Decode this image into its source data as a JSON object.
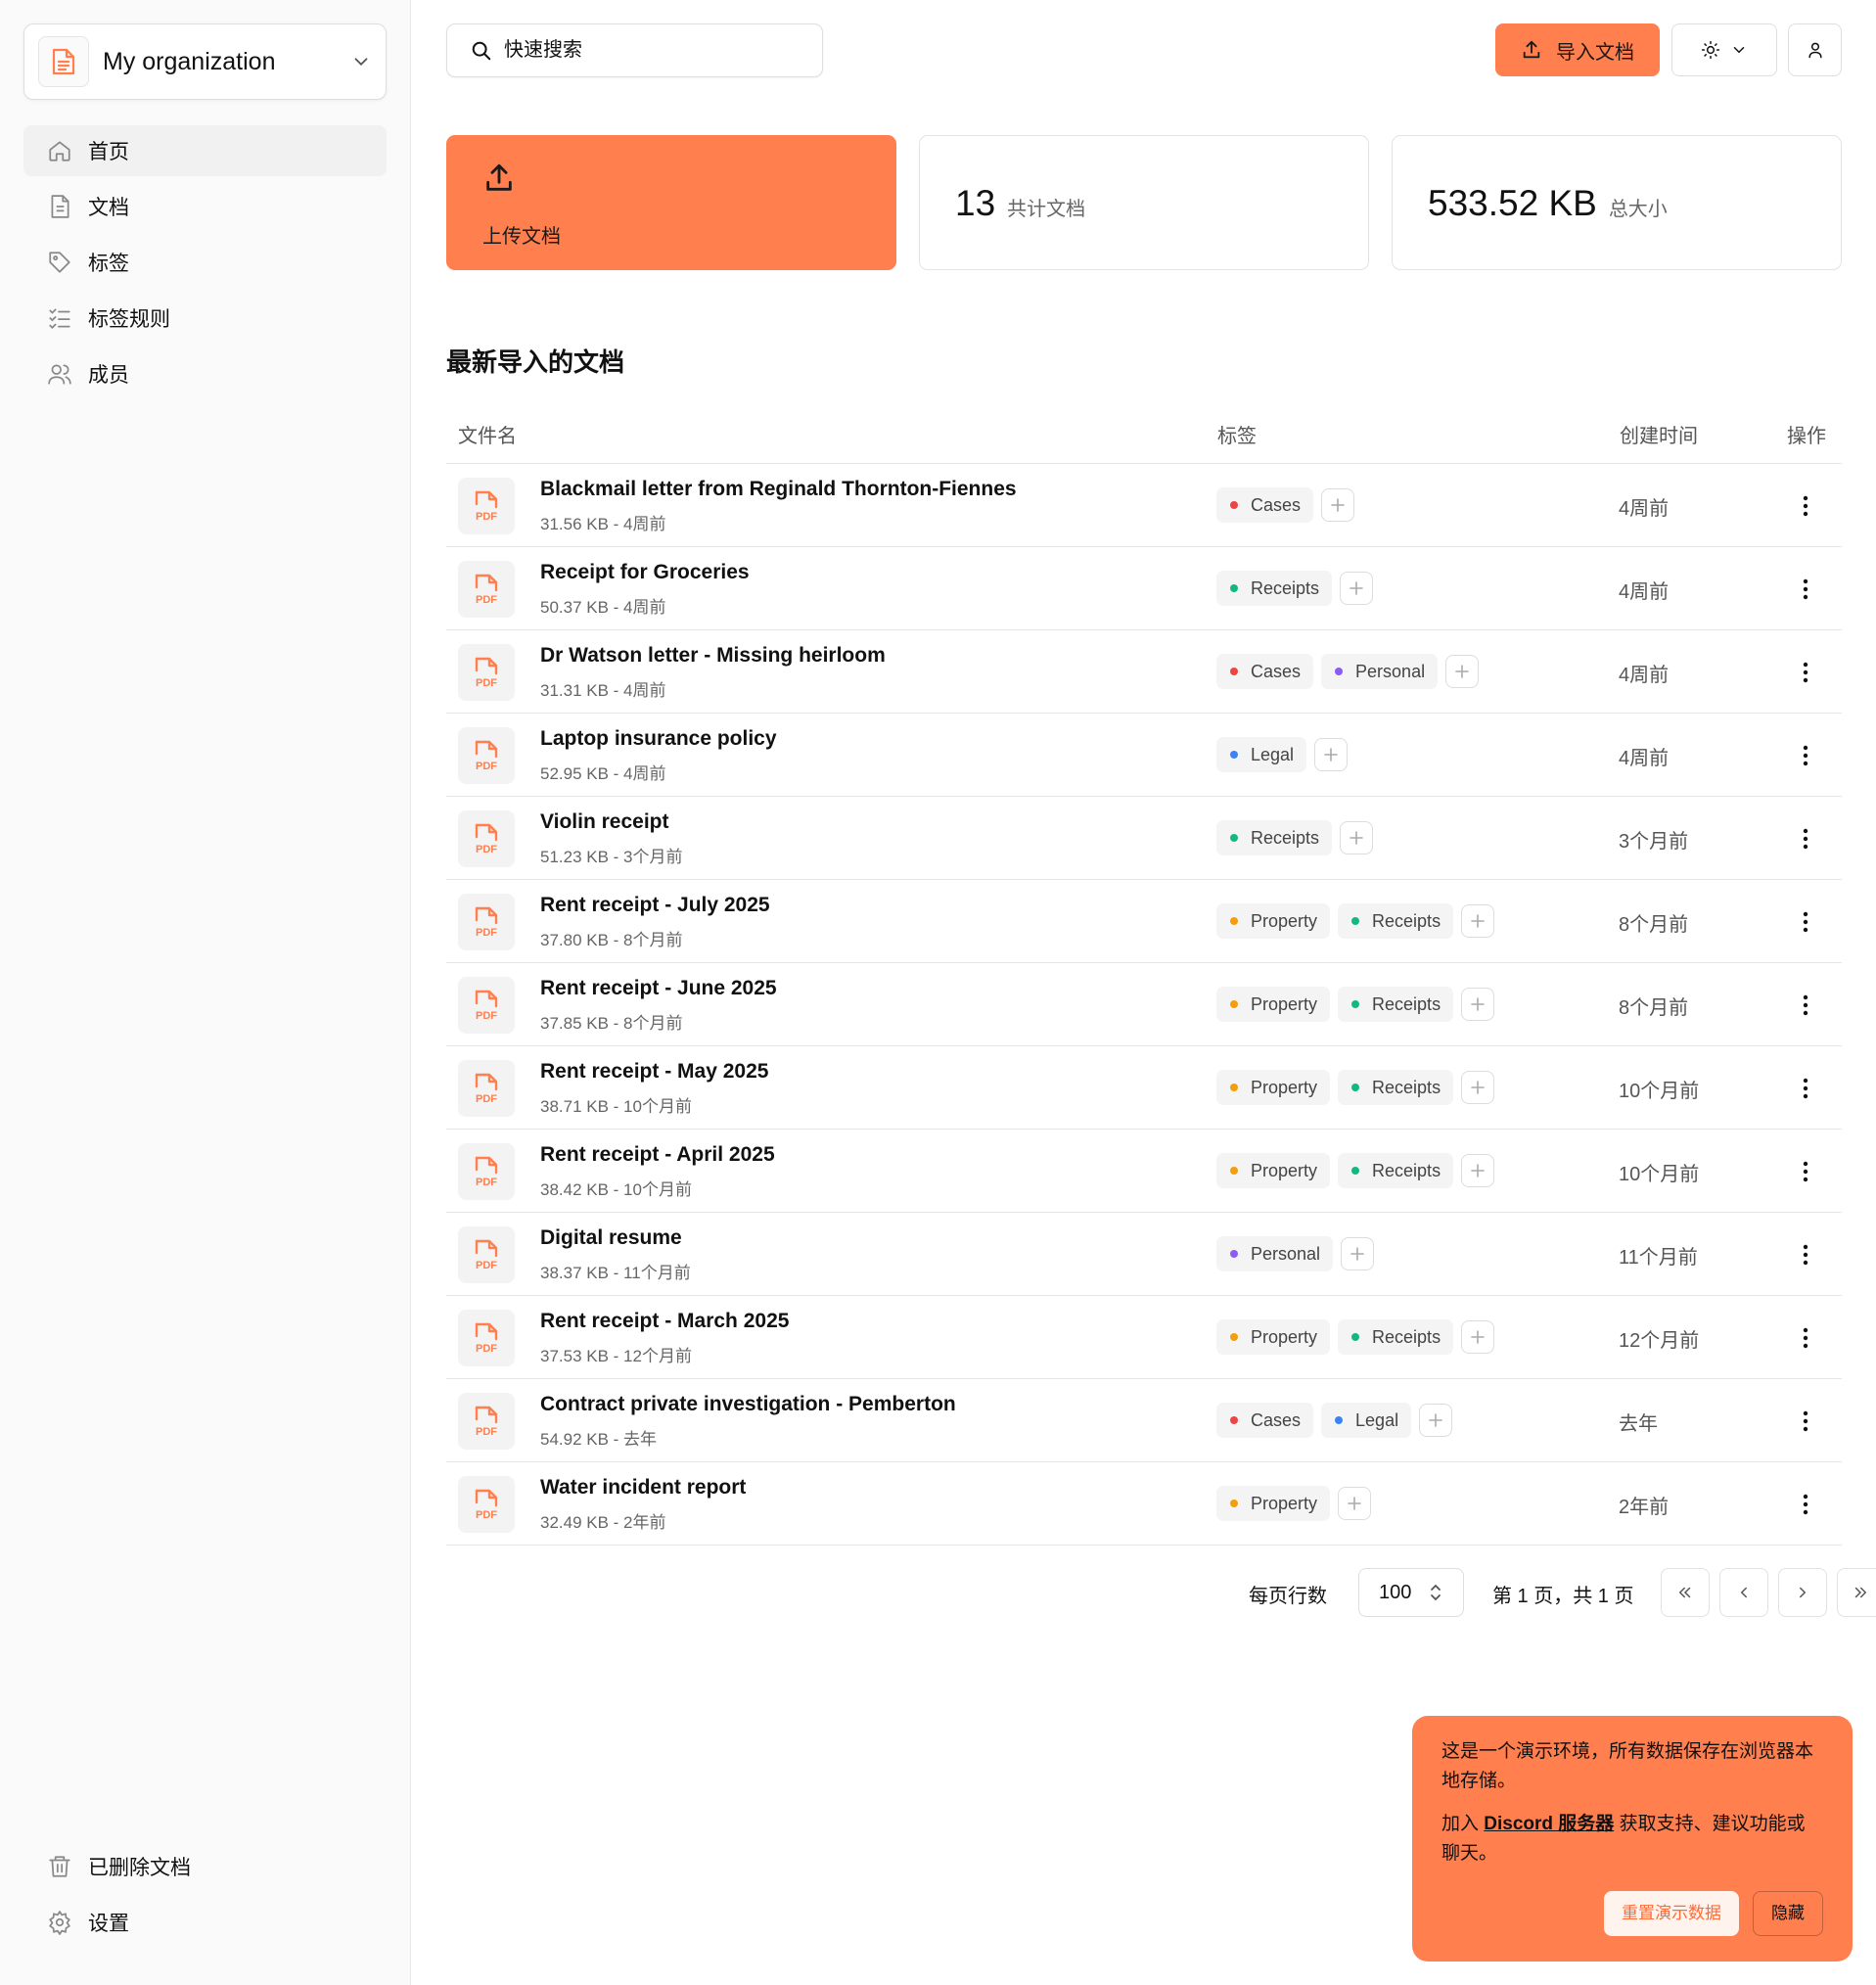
{
  "sidebar": {
    "org_name": "My organization",
    "nav": [
      {
        "label": "首页",
        "icon": "home-icon"
      },
      {
        "label": "文档",
        "icon": "document-icon"
      },
      {
        "label": "标签",
        "icon": "tag-icon"
      },
      {
        "label": "标签规则",
        "icon": "list-check-icon"
      },
      {
        "label": "成员",
        "icon": "users-icon"
      }
    ],
    "bottom_nav": [
      {
        "label": "已删除文档",
        "icon": "trash-icon"
      },
      {
        "label": "设置",
        "icon": "gear-icon"
      }
    ]
  },
  "header": {
    "search_placeholder": "快速搜索",
    "import_label": "导入文档"
  },
  "cards": {
    "upload_label": "上传文档",
    "doc_count": "13",
    "doc_count_caption": "共计文档",
    "total_size": "533.52 KB",
    "total_size_caption": "总大小"
  },
  "section_title": "最新导入的文档",
  "table": {
    "headers": {
      "name": "文件名",
      "tags": "标签",
      "created": "创建时间",
      "actions": "操作"
    },
    "rows": [
      {
        "title": "Blackmail letter from Reginald Thornton-Fiennes",
        "meta": "31.56 KB - 4周前",
        "tags": [
          {
            "name": "Cases",
            "color": "#ef4444"
          }
        ],
        "date": "4周前"
      },
      {
        "title": "Receipt for Groceries",
        "meta": "50.37 KB - 4周前",
        "tags": [
          {
            "name": "Receipts",
            "color": "#10b981"
          }
        ],
        "date": "4周前"
      },
      {
        "title": "Dr Watson letter - Missing heirloom",
        "meta": "31.31 KB - 4周前",
        "tags": [
          {
            "name": "Cases",
            "color": "#ef4444"
          },
          {
            "name": "Personal",
            "color": "#8b5cf6"
          }
        ],
        "date": "4周前"
      },
      {
        "title": "Laptop insurance policy",
        "meta": "52.95 KB - 4周前",
        "tags": [
          {
            "name": "Legal",
            "color": "#3b82f6"
          }
        ],
        "date": "4周前"
      },
      {
        "title": "Violin receipt",
        "meta": "51.23 KB - 3个月前",
        "tags": [
          {
            "name": "Receipts",
            "color": "#10b981"
          }
        ],
        "date": "3个月前"
      },
      {
        "title": "Rent receipt - July 2025",
        "meta": "37.80 KB - 8个月前",
        "tags": [
          {
            "name": "Property",
            "color": "#f59e0b"
          },
          {
            "name": "Receipts",
            "color": "#10b981"
          }
        ],
        "date": "8个月前"
      },
      {
        "title": "Rent receipt - June 2025",
        "meta": "37.85 KB - 8个月前",
        "tags": [
          {
            "name": "Property",
            "color": "#f59e0b"
          },
          {
            "name": "Receipts",
            "color": "#10b981"
          }
        ],
        "date": "8个月前"
      },
      {
        "title": "Rent receipt - May 2025",
        "meta": "38.71 KB - 10个月前",
        "tags": [
          {
            "name": "Property",
            "color": "#f59e0b"
          },
          {
            "name": "Receipts",
            "color": "#10b981"
          }
        ],
        "date": "10个月前"
      },
      {
        "title": "Rent receipt - April 2025",
        "meta": "38.42 KB - 10个月前",
        "tags": [
          {
            "name": "Property",
            "color": "#f59e0b"
          },
          {
            "name": "Receipts",
            "color": "#10b981"
          }
        ],
        "date": "10个月前"
      },
      {
        "title": "Digital resume",
        "meta": "38.37 KB - 11个月前",
        "tags": [
          {
            "name": "Personal",
            "color": "#8b5cf6"
          }
        ],
        "date": "11个月前"
      },
      {
        "title": "Rent receipt - March 2025",
        "meta": "37.53 KB - 12个月前",
        "tags": [
          {
            "name": "Property",
            "color": "#f59e0b"
          },
          {
            "name": "Receipts",
            "color": "#10b981"
          }
        ],
        "date": "12个月前"
      },
      {
        "title": "Contract private investigation - Pemberton",
        "meta": "54.92 KB - 去年",
        "tags": [
          {
            "name": "Cases",
            "color": "#ef4444"
          },
          {
            "name": "Legal",
            "color": "#3b82f6"
          }
        ],
        "date": "去年"
      },
      {
        "title": "Water incident report",
        "meta": "32.49 KB - 2年前",
        "tags": [
          {
            "name": "Property",
            "color": "#f59e0b"
          }
        ],
        "date": "2年前"
      }
    ]
  },
  "pagination": {
    "rows_per_page_label": "每页行数",
    "rows_per_page": "100",
    "page_info": "第 1 页，共 1 页"
  },
  "toast": {
    "line1": "这是一个演示环境，所有数据保存在浏览器本地存储。",
    "line2_prefix": "加入 ",
    "line2_link": "Discord 服务器",
    "line2_suffix": " 获取支持、建议功能或聊天。",
    "reset_label": "重置演示数据",
    "hide_label": "隐藏"
  },
  "colors": {
    "accent": "#ff7f4f",
    "pdf_icon": "#ff7f4f"
  }
}
